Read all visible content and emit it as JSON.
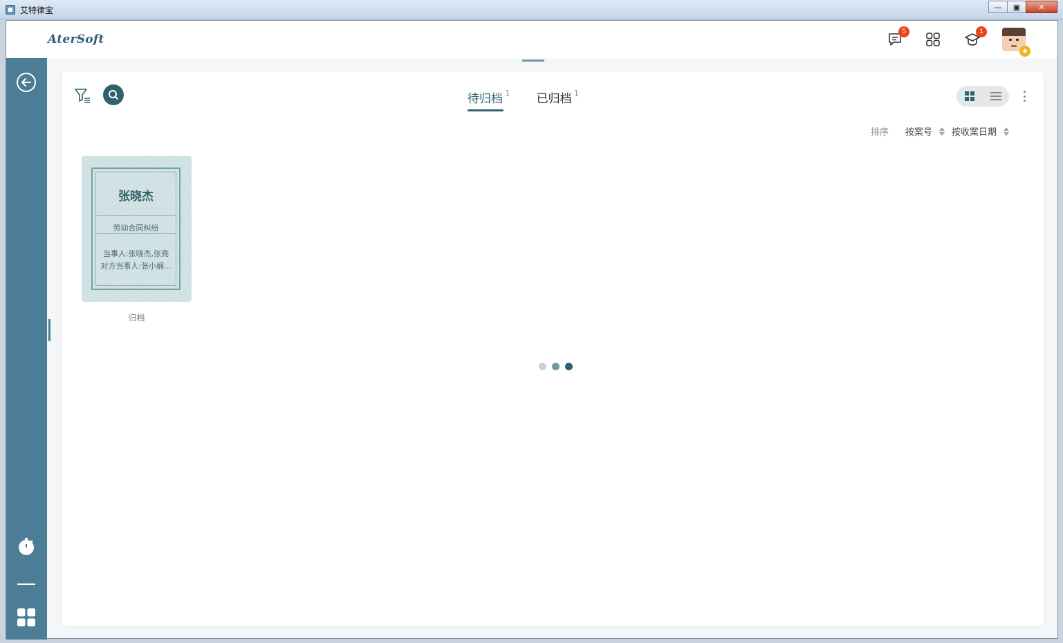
{
  "window": {
    "title": "艾特律宝"
  },
  "header": {
    "logo": "AterSoft",
    "messages_badge": "5",
    "learning_badge": "1"
  },
  "tabs": [
    {
      "label": "待归档",
      "count": "1",
      "active": true
    },
    {
      "label": "已归档",
      "count": "1",
      "active": false
    }
  ],
  "sort": {
    "label": "排序",
    "options": [
      "按案号",
      "按收案日期"
    ]
  },
  "cases": [
    {
      "name": "张晓杰",
      "type": "劳动合同纠纷",
      "parties": "当事人:张晓杰,张亮",
      "opposing": "对方当事人:张小娴...",
      "action": "归档"
    }
  ],
  "colors": {
    "sidebar": "#4b7d96",
    "accent": "#2f6270",
    "badge": "#e8431a",
    "card": "#cfe0e2"
  },
  "loader_dots": [
    "#c4d4d8",
    "#6f9aa3",
    "#2f6270"
  ]
}
